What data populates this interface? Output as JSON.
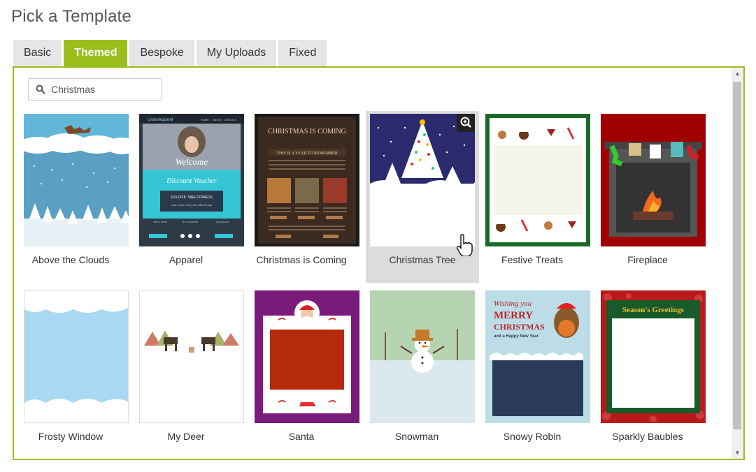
{
  "page": {
    "title": "Pick a Template"
  },
  "tabs": [
    {
      "label": "Basic",
      "active": false
    },
    {
      "label": "Themed",
      "active": true
    },
    {
      "label": "Bespoke",
      "active": false
    },
    {
      "label": "My Uploads",
      "active": false
    },
    {
      "label": "Fixed",
      "active": false
    }
  ],
  "search": {
    "value": "Christmas",
    "icon": "search-icon"
  },
  "templates": [
    {
      "name": "Above the Clouds"
    },
    {
      "name": "Apparel"
    },
    {
      "name": "Christmas is Coming"
    },
    {
      "name": "Christmas Tree"
    },
    {
      "name": "Festive Treats"
    },
    {
      "name": "Fireplace"
    },
    {
      "name": "Frosty Window"
    },
    {
      "name": "My Deer"
    },
    {
      "name": "Santa"
    },
    {
      "name": "Snowman"
    },
    {
      "name": "Snowy Robin"
    },
    {
      "name": "Sparkly Baubles"
    }
  ],
  "thumb_text": {
    "apparel_brand": "UnionApparel",
    "apparel_nav": [
      "HOME",
      "ABOUT",
      "CONTACT"
    ],
    "apparel_welcome": "Welcome",
    "apparel_voucher": "Discount Voucher",
    "apparel_code": "£15 OFF: WELCOME15",
    "apparel_code_sub": "Click to save on any order within 30 days",
    "apparel_footer": [
      "Get in Touch",
      "Be Connected",
      "My Account"
    ],
    "coming_title": "CHRISTMAS IS COMING",
    "coming_sub": "THIS IS A YEAR TO REMEMBER",
    "robin_line1": "Wishing you",
    "robin_line2": "MERRY",
    "robin_line3": "CHRISTMAS",
    "robin_line4": "and a Happy New Year",
    "baubles_title": "Season's Greetings"
  },
  "colors": {
    "accent": "#9bbe1c",
    "hover_bg": "#dcdcdc"
  }
}
